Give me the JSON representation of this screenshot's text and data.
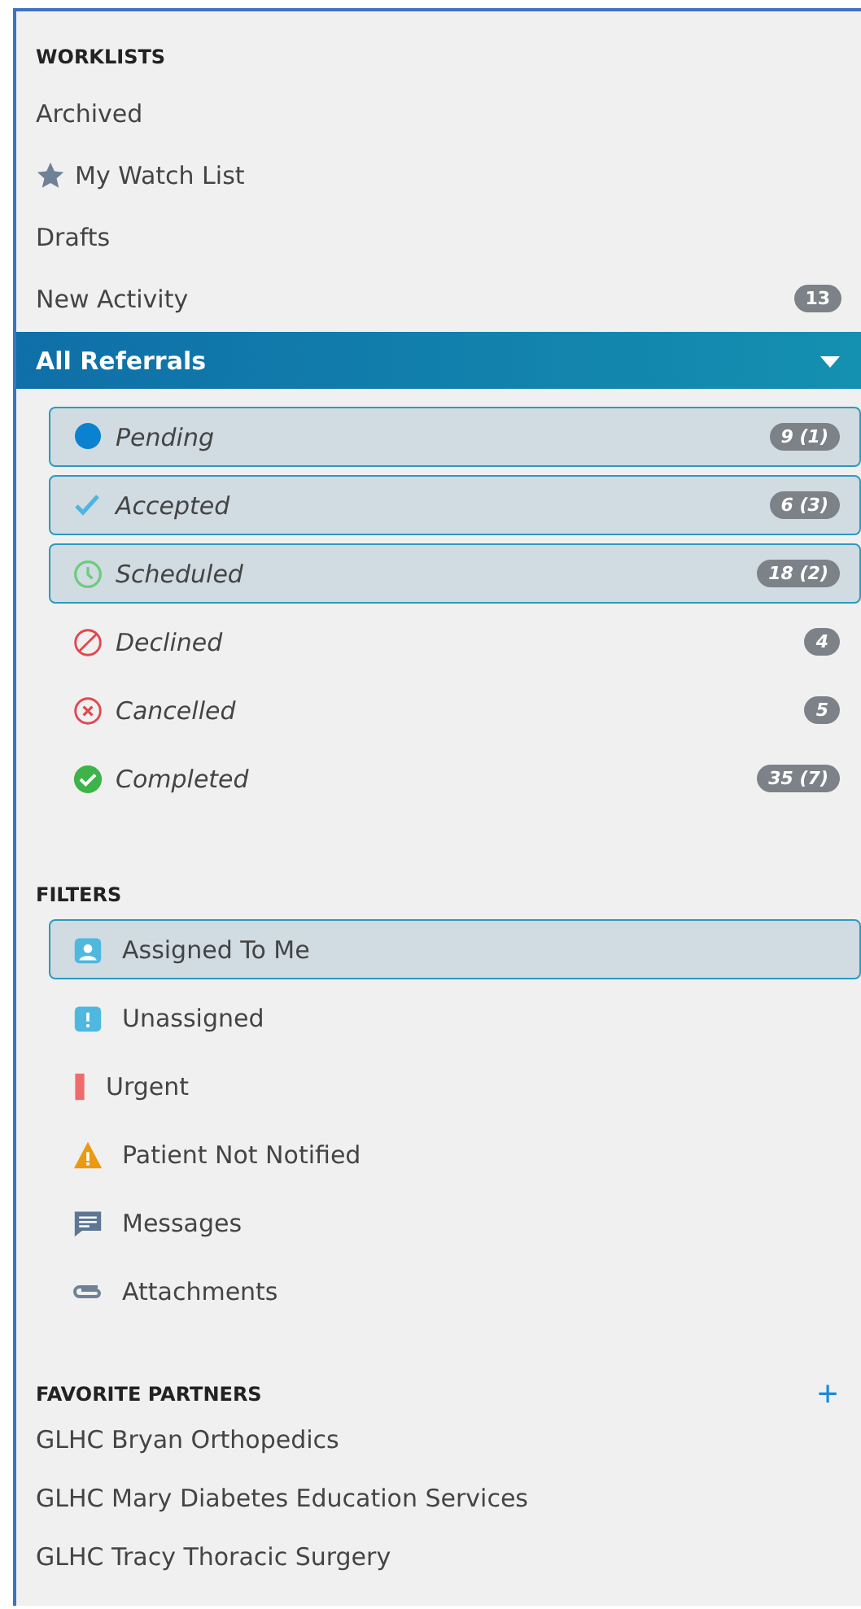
{
  "worklists": {
    "heading": "WORKLISTS",
    "items": [
      {
        "label": "Archived",
        "selected": false
      },
      {
        "label": "My Watch List",
        "kind": "star",
        "selected": false
      },
      {
        "label": "Drafts",
        "selected": false
      },
      {
        "label": "New Activity",
        "count": "13",
        "selected": false
      },
      {
        "label": "All Referrals",
        "selected": true,
        "expanded": true,
        "children": [
          {
            "label": "Pending",
            "kind": "dot",
            "count": "9 (1)",
            "selected": true
          },
          {
            "label": "Accepted",
            "kind": "check",
            "count": "6 (3)",
            "selected": true
          },
          {
            "label": "Scheduled",
            "kind": "clock",
            "count": "18 (2)",
            "selected": true
          },
          {
            "label": "Declined",
            "kind": "declined",
            "count": "4",
            "selected": false
          },
          {
            "label": "Cancelled",
            "kind": "cancelled",
            "count": "5",
            "selected": false
          },
          {
            "label": "Completed",
            "kind": "completed",
            "count": "35 (7)",
            "selected": false
          }
        ]
      }
    ]
  },
  "filters": {
    "heading": "FILTERS",
    "items": [
      {
        "label": "Assigned To Me",
        "kind": "assigned",
        "selected": true
      },
      {
        "label": "Unassigned",
        "kind": "unassigned",
        "selected": false
      },
      {
        "label": "Urgent",
        "kind": "urgent",
        "selected": false
      },
      {
        "label": "Patient Not Notified",
        "kind": "warning",
        "selected": false
      },
      {
        "label": "Messages",
        "kind": "message",
        "selected": false
      },
      {
        "label": "Attachments",
        "kind": "attachment",
        "selected": false
      }
    ]
  },
  "favorite_partners": {
    "heading": "FAVORITE PARTNERS",
    "add_button": "+",
    "items": [
      "GLHC Bryan Orthopedics",
      "GLHC Mary Diabetes Education Services",
      "GLHC Tracy Thoracic Surgery"
    ]
  }
}
